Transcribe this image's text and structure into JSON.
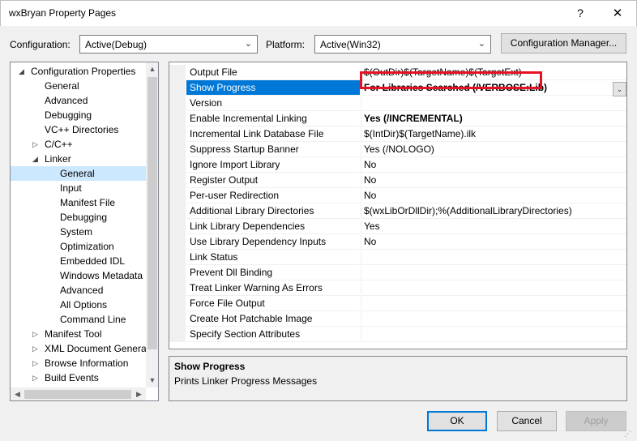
{
  "window": {
    "title": "wxBryan Property Pages",
    "help_glyph": "?",
    "close_glyph": "✕"
  },
  "toolbar": {
    "configuration_label": "Configuration:",
    "configuration_value": "Active(Debug)",
    "platform_label": "Platform:",
    "platform_value": "Active(Win32)",
    "config_manager_label": "Configuration Manager...",
    "chevron_glyph": "⌄"
  },
  "tree": {
    "items": [
      {
        "label": "Configuration Properties",
        "level": 0,
        "twisty": "◢"
      },
      {
        "label": "General",
        "level": 1,
        "twisty": ""
      },
      {
        "label": "Advanced",
        "level": 1,
        "twisty": ""
      },
      {
        "label": "Debugging",
        "level": 1,
        "twisty": ""
      },
      {
        "label": "VC++ Directories",
        "level": 1,
        "twisty": ""
      },
      {
        "label": "C/C++",
        "level": 1,
        "twisty": "▷"
      },
      {
        "label": "Linker",
        "level": 1,
        "twisty": "◢"
      },
      {
        "label": "General",
        "level": 2,
        "twisty": "",
        "selected": true
      },
      {
        "label": "Input",
        "level": 2,
        "twisty": ""
      },
      {
        "label": "Manifest File",
        "level": 2,
        "twisty": ""
      },
      {
        "label": "Debugging",
        "level": 2,
        "twisty": ""
      },
      {
        "label": "System",
        "level": 2,
        "twisty": ""
      },
      {
        "label": "Optimization",
        "level": 2,
        "twisty": ""
      },
      {
        "label": "Embedded IDL",
        "level": 2,
        "twisty": ""
      },
      {
        "label": "Windows Metadata",
        "level": 2,
        "twisty": ""
      },
      {
        "label": "Advanced",
        "level": 2,
        "twisty": ""
      },
      {
        "label": "All Options",
        "level": 2,
        "twisty": ""
      },
      {
        "label": "Command Line",
        "level": 2,
        "twisty": ""
      },
      {
        "label": "Manifest Tool",
        "level": 1,
        "twisty": "▷"
      },
      {
        "label": "XML Document Genera",
        "level": 1,
        "twisty": "▷"
      },
      {
        "label": "Browse Information",
        "level": 1,
        "twisty": "▷"
      },
      {
        "label": "Build Events",
        "level": 1,
        "twisty": "▷"
      }
    ],
    "scroll_up": "▲",
    "scroll_down": "▼",
    "scroll_left": "◀",
    "scroll_right": "▶"
  },
  "properties": [
    {
      "name": "Output File",
      "value": "$(OutDir)$(TargetName)$(TargetExt)",
      "bold": false
    },
    {
      "name": "Show Progress",
      "value": "For Libraries Searched (/VERBOSE:Lib)",
      "bold": true,
      "selected": true
    },
    {
      "name": "Version",
      "value": "",
      "bold": false
    },
    {
      "name": "Enable Incremental Linking",
      "value": "Yes (/INCREMENTAL)",
      "bold": true
    },
    {
      "name": "Incremental Link Database File",
      "value": "$(IntDir)$(TargetName).ilk",
      "bold": false
    },
    {
      "name": "Suppress Startup Banner",
      "value": "Yes (/NOLOGO)",
      "bold": false
    },
    {
      "name": "Ignore Import Library",
      "value": "No",
      "bold": false
    },
    {
      "name": "Register Output",
      "value": "No",
      "bold": false
    },
    {
      "name": "Per-user Redirection",
      "value": "No",
      "bold": false
    },
    {
      "name": "Additional Library Directories",
      "value": "$(wxLibOrDllDir);%(AdditionalLibraryDirectories)",
      "bold": false
    },
    {
      "name": "Link Library Dependencies",
      "value": "Yes",
      "bold": false
    },
    {
      "name": "Use Library Dependency Inputs",
      "value": "No",
      "bold": false
    },
    {
      "name": "Link Status",
      "value": "",
      "bold": false
    },
    {
      "name": "Prevent Dll Binding",
      "value": "",
      "bold": false
    },
    {
      "name": "Treat Linker Warning As Errors",
      "value": "",
      "bold": false
    },
    {
      "name": "Force File Output",
      "value": "",
      "bold": false
    },
    {
      "name": "Create Hot Patchable Image",
      "value": "",
      "bold": false
    },
    {
      "name": "Specify Section Attributes",
      "value": "",
      "bold": false
    }
  ],
  "description": {
    "title": "Show Progress",
    "text": "Prints Linker Progress Messages"
  },
  "buttons": {
    "ok": "OK",
    "cancel": "Cancel",
    "apply": "Apply"
  },
  "colors": {
    "selection": "#0078d7",
    "highlight_box": "#e81123",
    "tree_selection": "#cce8ff"
  }
}
